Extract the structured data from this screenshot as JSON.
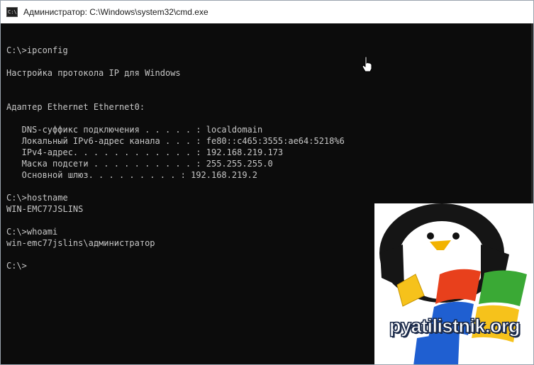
{
  "window": {
    "title": "Администратор: C:\\Windows\\system32\\cmd.exe",
    "icon": "cmd-icon",
    "icon_glyph": "C:\\"
  },
  "console_lines": [
    "",
    "C:\\>ipconfig",
    "",
    "Настройка протокола IP для Windows",
    "",
    "",
    "Адаптер Ethernet Ethernet0:",
    "",
    "   DNS-суффикс подключения . . . . . : localdomain",
    "   Локальный IPv6-адрес канала . . . : fe80::c465:3555:ae64:5218%6",
    "   IPv4-адрес. . . . . . . . . . . . : 192.168.219.173",
    "   Маска подсети . . . . . . . . . . : 255.255.255.0",
    "   Основной шлюз. . . . . . . . . : 192.168.219.2",
    "",
    "C:\\>hostname",
    "WIN-EMC77JSLINS",
    "",
    "C:\\>whoami",
    "win-emc77jslins\\администратор",
    "",
    "C:\\>"
  ],
  "logo": {
    "text": "pyatilistnik.org",
    "colors": {
      "red": "#e8401c",
      "green": "#3aa935",
      "blue": "#1f5fd1",
      "yellow": "#f6c21b",
      "beak": "#f2b300"
    }
  },
  "colors": {
    "console_bg": "#0c0c0c",
    "console_fg": "#c6c6c6",
    "titlebar_bg": "#ffffff"
  }
}
